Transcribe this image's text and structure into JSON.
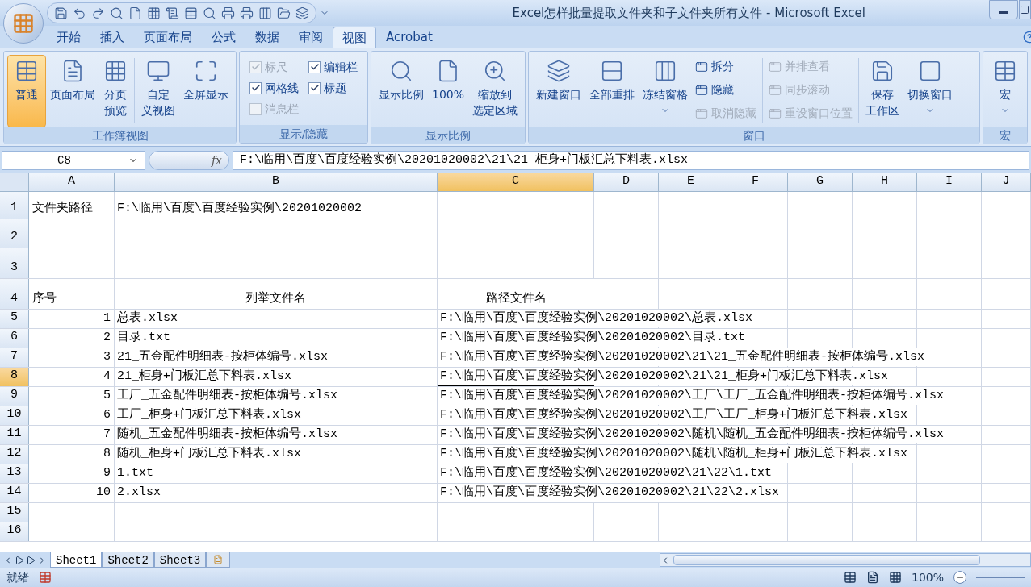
{
  "window": {
    "title": "Excel怎样批量提取文件夹和子文件夹所有文件 - Microsoft Excel"
  },
  "tabs": [
    {
      "label": "开始",
      "selected": false
    },
    {
      "label": "插入",
      "selected": false
    },
    {
      "label": "页面布局",
      "selected": false
    },
    {
      "label": "公式",
      "selected": false
    },
    {
      "label": "数据",
      "selected": false
    },
    {
      "label": "审阅",
      "selected": false
    },
    {
      "label": "视图",
      "selected": true
    },
    {
      "label": "Acrobat",
      "selected": false
    }
  ],
  "ribbon": {
    "workbook_views": {
      "label": "工作簿视图",
      "buttons": [
        {
          "lines": [
            "普通"
          ],
          "selected": true
        },
        {
          "lines": [
            "页面布局"
          ],
          "selected": false
        },
        {
          "lines": [
            "分页",
            "预览"
          ],
          "selected": false
        },
        {
          "lines": [
            "自定",
            "义视图"
          ],
          "selected": false
        },
        {
          "lines": [
            "全屏显示"
          ],
          "selected": false
        }
      ]
    },
    "show_hide": {
      "label": "显示/隐藏",
      "checks": [
        {
          "label": "标尺",
          "checked": true,
          "disabled": true
        },
        {
          "label": "编辑栏",
          "checked": true,
          "disabled": false
        },
        {
          "label": "网格线",
          "checked": true,
          "disabled": false
        },
        {
          "label": "标题",
          "checked": true,
          "disabled": false
        },
        {
          "label": "消息栏",
          "checked": false,
          "disabled": true
        }
      ]
    },
    "zoom": {
      "label": "显示比例",
      "buttons": [
        {
          "lines": [
            "显示比例"
          ]
        },
        {
          "lines": [
            "100%"
          ]
        },
        {
          "lines": [
            "缩放到",
            "选定区域"
          ]
        }
      ]
    },
    "window": {
      "label": "窗口",
      "large": [
        {
          "lines": [
            "新建窗口"
          ],
          "dropdown": false
        },
        {
          "lines": [
            "全部重排"
          ],
          "dropdown": false
        },
        {
          "lines": [
            "冻结窗格"
          ],
          "dropdown": true
        }
      ],
      "small_left": [
        {
          "label": "拆分",
          "disabled": false
        },
        {
          "label": "隐藏",
          "disabled": false
        },
        {
          "label": "取消隐藏",
          "disabled": true
        }
      ],
      "small_right": [
        {
          "label": "并排查看",
          "disabled": true
        },
        {
          "label": "同步滚动",
          "disabled": true
        },
        {
          "label": "重设窗口位置",
          "disabled": true
        }
      ],
      "large_right": [
        {
          "lines": [
            "保存",
            "工作区"
          ],
          "dropdown": false
        },
        {
          "lines": [
            "切换窗口"
          ],
          "dropdown": true
        }
      ]
    },
    "macros": {
      "label": "宏",
      "button": {
        "lines": [
          "宏"
        ],
        "dropdown": true
      }
    }
  },
  "formula_bar": {
    "name_box": "C8",
    "function_label": "fx",
    "value": "F:\\临用\\百度\\百度经验实例\\20201020002\\21\\21_柜身+门板汇总下料表.xlsx"
  },
  "columns": [
    {
      "label": "A",
      "selected": false
    },
    {
      "label": "B",
      "selected": false
    },
    {
      "label": "C",
      "selected": true
    },
    {
      "label": "D",
      "selected": false
    },
    {
      "label": "E",
      "selected": false
    },
    {
      "label": "F",
      "selected": false
    },
    {
      "label": "G",
      "selected": false
    },
    {
      "label": "H",
      "selected": false
    },
    {
      "label": "I",
      "selected": false
    },
    {
      "label": "J",
      "selected": false
    }
  ],
  "rows": [
    {
      "number": "1",
      "selected": false,
      "a": "文件夹路径",
      "b": "F:\\临用\\百度\\百度经验实例\\20201020002",
      "c": ""
    },
    {
      "number": "2",
      "selected": false,
      "a": "",
      "b": "",
      "c": ""
    },
    {
      "number": "3",
      "selected": false,
      "a": "",
      "b": "",
      "c": ""
    },
    {
      "number": "4",
      "selected": false,
      "a": "序号",
      "b": "列举文件名",
      "c": "路径文件名"
    },
    {
      "number": "5",
      "selected": false,
      "a": "1",
      "b": "总表.xlsx",
      "c": "F:\\临用\\百度\\百度经验实例\\20201020002\\总表.xlsx"
    },
    {
      "number": "6",
      "selected": false,
      "a": "2",
      "b": "目录.txt",
      "c": "F:\\临用\\百度\\百度经验实例\\20201020002\\目录.txt"
    },
    {
      "number": "7",
      "selected": false,
      "a": "3",
      "b": "21_五金配件明细表-按柜体编号.xlsx",
      "c": "F:\\临用\\百度\\百度经验实例\\20201020002\\21\\21_五金配件明细表-按柜体编号.xlsx"
    },
    {
      "number": "8",
      "selected": true,
      "a": "4",
      "b": "21_柜身+门板汇总下料表.xlsx",
      "c": "F:\\临用\\百度\\百度经验实例\\20201020002\\21\\21_柜身+门板汇总下料表.xlsx"
    },
    {
      "number": "9",
      "selected": false,
      "a": "5",
      "b": "工厂_五金配件明细表-按柜体编号.xlsx",
      "c": "F:\\临用\\百度\\百度经验实例\\20201020002\\工厂\\工厂_五金配件明细表-按柜体编号.xlsx"
    },
    {
      "number": "10",
      "selected": false,
      "a": "6",
      "b": "工厂_柜身+门板汇总下料表.xlsx",
      "c": "F:\\临用\\百度\\百度经验实例\\20201020002\\工厂\\工厂_柜身+门板汇总下料表.xlsx"
    },
    {
      "number": "11",
      "selected": false,
      "a": "7",
      "b": "随机_五金配件明细表-按柜体编号.xlsx",
      "c": "F:\\临用\\百度\\百度经验实例\\20201020002\\随机\\随机_五金配件明细表-按柜体编号.xlsx"
    },
    {
      "number": "12",
      "selected": false,
      "a": "8",
      "b": "随机_柜身+门板汇总下料表.xlsx",
      "c": "F:\\临用\\百度\\百度经验实例\\20201020002\\随机\\随机_柜身+门板汇总下料表.xlsx"
    },
    {
      "number": "13",
      "selected": false,
      "a": "9",
      "b": "1.txt",
      "c": "F:\\临用\\百度\\百度经验实例\\20201020002\\21\\22\\1.txt"
    },
    {
      "number": "14",
      "selected": false,
      "a": "10",
      "b": "2.xlsx",
      "c": "F:\\临用\\百度\\百度经验实例\\20201020002\\21\\22\\2.xlsx"
    },
    {
      "number": "15",
      "selected": false,
      "a": "",
      "b": "",
      "c": ""
    },
    {
      "number": "16",
      "selected": false,
      "a": "",
      "b": "",
      "c": ""
    }
  ],
  "sheet_tabs": [
    {
      "label": "Sheet1",
      "selected": true
    },
    {
      "label": "Sheet2",
      "selected": false
    },
    {
      "label": "Sheet3",
      "selected": false
    }
  ],
  "status_bar": {
    "status": "就绪",
    "zoom": "100%"
  }
}
